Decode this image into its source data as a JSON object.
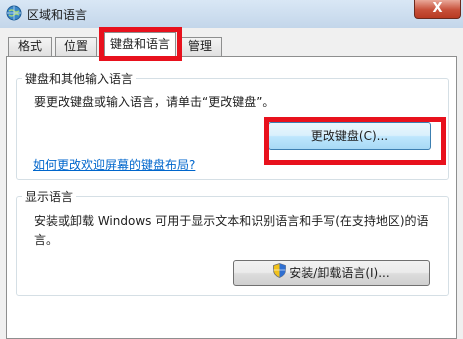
{
  "window": {
    "title": "区域和语言",
    "close_label": "X"
  },
  "tabs": [
    {
      "label": "格式"
    },
    {
      "label": "位置"
    },
    {
      "label": "键盘和语言"
    },
    {
      "label": "管理"
    }
  ],
  "keyboard_group": {
    "title": "键盘和其他输入语言",
    "description": "要更改键盘或输入语言，请单击“更改键盘”。",
    "change_button": "更改键盘(C)...",
    "help_link": "如何更改欢迎屏幕的键盘布局?"
  },
  "display_group": {
    "title": "显示语言",
    "description_line1": "安装或卸载 Windows 可用于显示文本和识别语言和手写(在支持地区)的语",
    "description_line2": "言。",
    "install_button": "安装/卸载语言(I)..."
  },
  "colors": {
    "highlight": "#e8111d",
    "link": "#0066cc"
  }
}
